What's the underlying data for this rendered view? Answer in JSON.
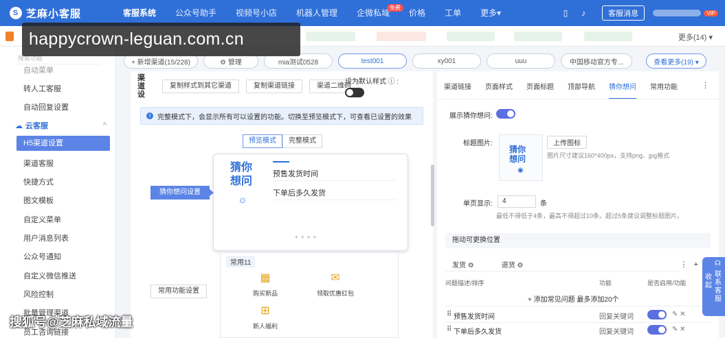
{
  "app": {
    "logo": "芝麻小客服"
  },
  "topnav": {
    "items": [
      "客服系统",
      "公众号助手",
      "视频号小店",
      "机器人管理",
      "企微私域",
      "价格",
      "工单",
      "更多▾"
    ],
    "free_badge": "免费",
    "kefu_msg": "客服消息",
    "vip": "VIP"
  },
  "tabs": {
    "more": "更多(14) ▾"
  },
  "watermark": {
    "text": "happycrown-leguan.com.cn",
    "bottom": "搜狐号@芝麻私域流量"
  },
  "channels": {
    "add": "+ 新增渠道(15/228)",
    "manage": "⚙ 管理",
    "list": [
      "mia测试0528",
      "test001",
      "xy001",
      "uuu",
      "中国移动官方专..."
    ],
    "view_more": "查看更多(19) ▾"
  },
  "sidebar": {
    "search": "搜索功能",
    "items_top": [
      "自动菜单",
      "转人工客服",
      "自动回复设置"
    ],
    "group": "云客服",
    "items": [
      "H5渠道设置",
      "渠道客服",
      "快捷方式",
      "图文模板",
      "自定义菜单",
      "用户消息列表",
      "公众号通知",
      "自定义微信推送",
      "风险控制",
      "批量管理渠道",
      "员工咨询链接"
    ]
  },
  "center": {
    "vertical_title": "渠道设",
    "buttons": [
      "复制样式到其它渠道",
      "复制渠道链接",
      "渠道二维码"
    ],
    "default_style": "设为默认样式",
    "info": "完整模式下，会显示所有可以设置的功能。切换至预览模式下，可查看已设置的效果",
    "modes": [
      "预览模式",
      "完整模式"
    ],
    "guess_title": "猜你想问",
    "questions": [
      "预售发货时间",
      "下单后多久发货"
    ],
    "guess_setting": "猜你想问设置",
    "common_setting": "常用功能设置",
    "common_title": "常用11",
    "functions": [
      "购买新品",
      "领取优惠红包",
      "新人福利"
    ]
  },
  "right": {
    "tabs": [
      "渠道链接",
      "页面样式",
      "页面标题",
      "顶部导航",
      "猜你想问",
      "常用功能"
    ],
    "show_guess": "展示猜你想问:",
    "title_image": "标题图片:",
    "upload": "上传图标",
    "upload_hint": "图片尺寸建议160*400px，支持png、jpg格式",
    "thumb_text": "猜你想问",
    "per_page": "单页显示:",
    "per_page_value": "4",
    "per_page_unit": "条",
    "per_page_hint": "最低不得低于4条，最高不得超过10条。超过5条建议调整标题图片。",
    "drag_section": "拖动可更换位置",
    "tags": [
      "发货",
      "退货"
    ],
    "headers": [
      "问题描述/排序",
      "功能",
      "是否启用/功能"
    ],
    "add": "+ 添加常见问题 最多添加20个",
    "rows": [
      {
        "q": "预售发货时间",
        "func": "回复关键词"
      },
      {
        "q": "下单后多久发货",
        "func": "回复关键词"
      }
    ]
  },
  "float": {
    "collapse": "收起",
    "contact": "联系客服"
  }
}
